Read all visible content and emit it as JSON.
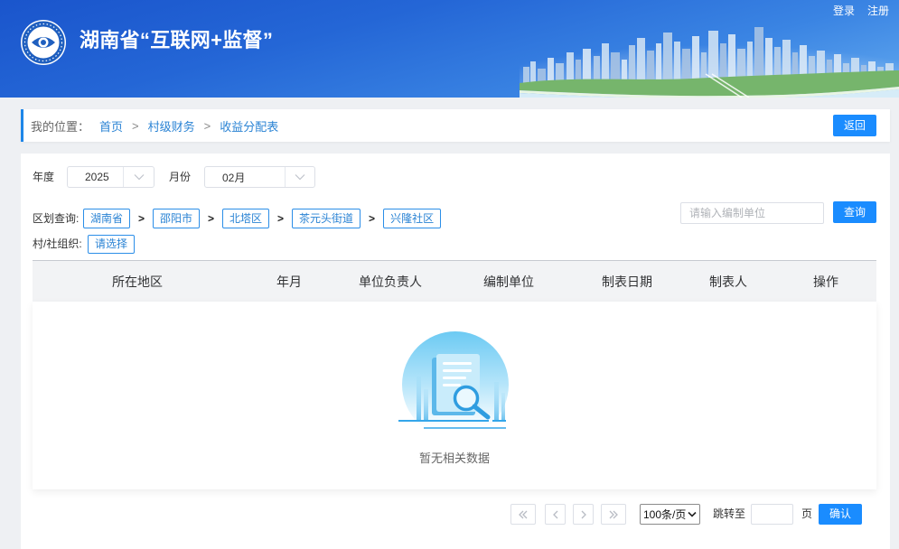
{
  "header": {
    "title": "湖南省“互联网+监督”",
    "links": {
      "login": "登录",
      "register": "注册"
    }
  },
  "breadcrumb": {
    "prefix": "我的位置：",
    "separator": ">",
    "items": [
      "首页",
      "村级财务",
      "收益分配表"
    ],
    "back_button": "返回"
  },
  "filters": {
    "year": {
      "label": "年度",
      "value": "2025"
    },
    "month": {
      "label": "月份",
      "value": "02月"
    },
    "region": {
      "label": "区划查询:",
      "separator": ">",
      "path": [
        "湖南省",
        "邵阳市",
        "北塔区",
        "茶元头街道",
        "兴隆社区"
      ]
    },
    "organization": {
      "label": "村/社组织:",
      "select_label": "请选择"
    },
    "unit_search": {
      "placeholder": "请输入编制单位",
      "button": "查询"
    }
  },
  "table": {
    "columns": [
      "所在地区",
      "年月",
      "单位负责人",
      "编制单位",
      "制表日期",
      "制表人",
      "操作"
    ],
    "empty_text": "暂无相关数据"
  },
  "pagination": {
    "page_size": "100条/页",
    "jump_label": "跳转至",
    "page_unit": "页",
    "confirm_button": "确认"
  },
  "icons": {
    "logo": "supervision-eye-logo-icon",
    "select_arrow": "chevron-down-icon",
    "first_page": "double-chevron-left-icon",
    "prev_page": "chevron-left-icon",
    "next_page": "chevron-right-icon",
    "last_page": "double-chevron-right-icon",
    "empty_state": "document-search-illustration"
  },
  "colors": {
    "primary": "#1a8cff",
    "link": "#2a83d4",
    "header_dark": "#1a55cc",
    "header_light": "#62a9ef",
    "page_background": "#eef0f3"
  }
}
